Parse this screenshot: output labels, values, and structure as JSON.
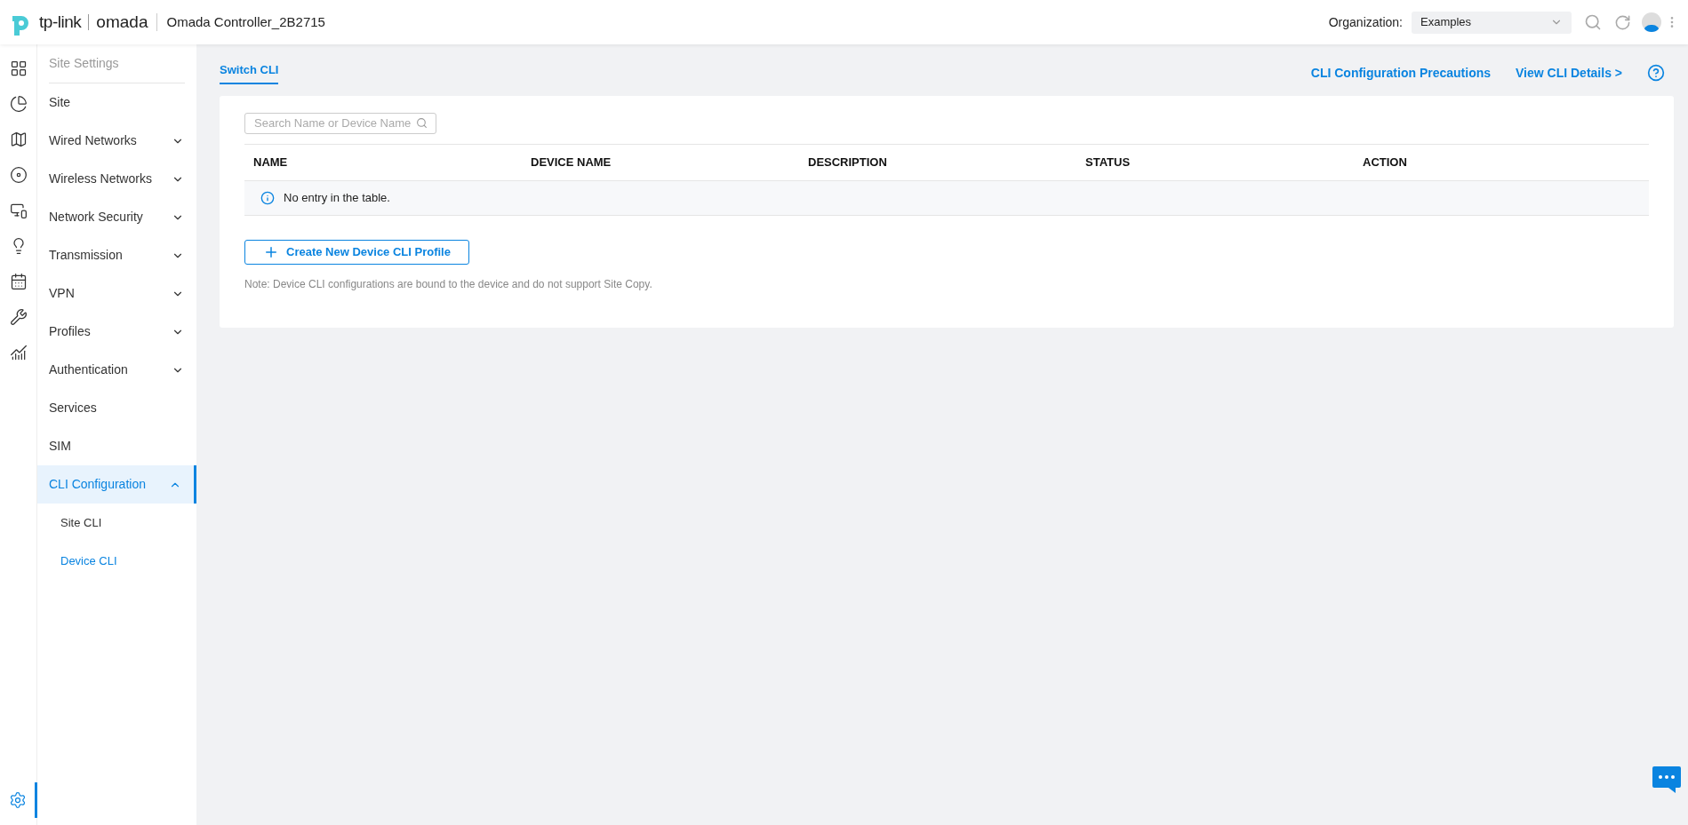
{
  "header": {
    "brand": "tp-link",
    "product": "omada",
    "controller": "Omada Controller_2B2715",
    "organization_label": "Organization:",
    "organization_value": "Examples"
  },
  "rail": [
    {
      "kind": "apps",
      "selected": false
    },
    {
      "kind": "chart",
      "selected": false
    },
    {
      "kind": "map",
      "selected": false
    },
    {
      "kind": "device",
      "selected": false
    },
    {
      "kind": "devices",
      "selected": false
    },
    {
      "kind": "bulb",
      "selected": false
    },
    {
      "kind": "calendar",
      "selected": false
    },
    {
      "kind": "wrench",
      "selected": false
    },
    {
      "kind": "stats",
      "selected": false
    },
    {
      "kind": "settings",
      "selected": true
    }
  ],
  "sidebar": {
    "title": "Site Settings",
    "items": [
      {
        "label": "Site",
        "expandable": false,
        "selected": false
      },
      {
        "label": "Wired Networks",
        "expandable": true,
        "expanded": false,
        "selected": false
      },
      {
        "label": "Wireless Networks",
        "expandable": true,
        "expanded": false,
        "selected": false
      },
      {
        "label": "Network Security",
        "expandable": true,
        "expanded": false,
        "selected": false
      },
      {
        "label": "Transmission",
        "expandable": true,
        "expanded": false,
        "selected": false
      },
      {
        "label": "VPN",
        "expandable": true,
        "expanded": false,
        "selected": false
      },
      {
        "label": "Profiles",
        "expandable": true,
        "expanded": false,
        "selected": false
      },
      {
        "label": "Authentication",
        "expandable": true,
        "expanded": false,
        "selected": false
      },
      {
        "label": "Services",
        "expandable": false,
        "selected": false
      },
      {
        "label": "SIM",
        "expandable": false,
        "selected": false
      },
      {
        "label": "CLI Configuration",
        "expandable": true,
        "expanded": true,
        "selected": true,
        "children": [
          {
            "label": "Site CLI",
            "selected": false
          },
          {
            "label": "Device CLI",
            "selected": true
          }
        ]
      }
    ]
  },
  "tabs": [
    {
      "label": "Switch CLI",
      "selected": true
    }
  ],
  "links": [
    "CLI Configuration Precautions",
    "View CLI Details >"
  ],
  "search": {
    "placeholder": "Search Name or Device Name"
  },
  "table": {
    "columns": [
      "NAME",
      "DEVICE NAME",
      "DESCRIPTION",
      "STATUS",
      "ACTION"
    ],
    "empty": "No entry in the table."
  },
  "create_button": "Create New Device CLI Profile",
  "note": "Note: Device CLI configurations are bound to the device and do not support Site Copy."
}
